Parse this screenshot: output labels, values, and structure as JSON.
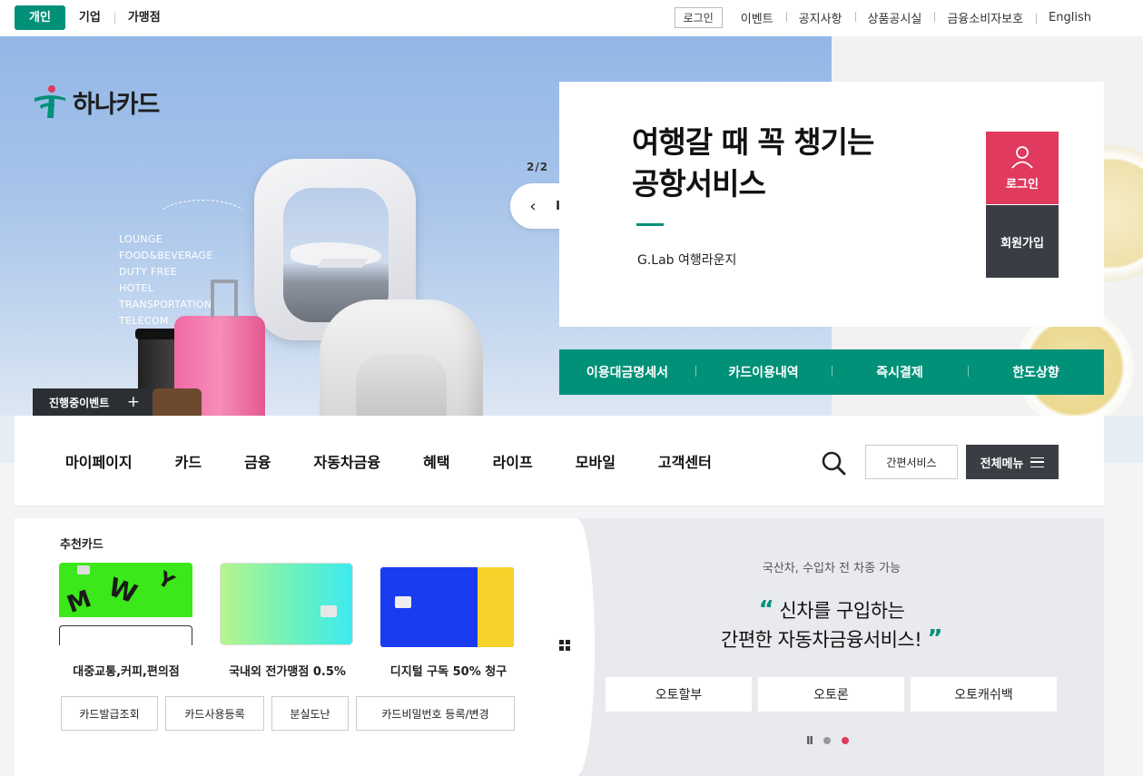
{
  "top_tabs": [
    "개인",
    "기업",
    "가맹점"
  ],
  "util": {
    "login": "로그인",
    "links": [
      "이벤트",
      "공지사항",
      "상품공시실",
      "금융소비자보호",
      "English"
    ]
  },
  "brand": {
    "name": "하나카드",
    "accent": "#009178"
  },
  "hero": {
    "keywords": [
      "LOUNGE",
      "FOOD&BEVERAGE",
      "DUTY FREE",
      "HOTEL",
      "TRANSPORTATION",
      "TELECOM"
    ],
    "event_tag": "진행중이벤트",
    "event_plus": "+",
    "counter": "2/2",
    "prev": "‹",
    "pause": "II",
    "next": "›"
  },
  "promo": {
    "title_line1": "여행갈 때 꼭 챙기는",
    "title_line2": "공항서비스",
    "subtitle": "G.Lab 여행라운지",
    "login": "로그인",
    "join": "회원가입"
  },
  "quick_links": [
    "이용대금명세서",
    "카드이용내역",
    "즉시결제",
    "한도상향"
  ],
  "gnb": {
    "menu": [
      "마이페이지",
      "카드",
      "금융",
      "자동차금융",
      "혜택",
      "라이프",
      "모바일",
      "고객센터"
    ],
    "easy_service": "간편서비스",
    "all_menu": "전체메뉴"
  },
  "reco": {
    "label": "추천카드",
    "cards": [
      "대중교통,커피,편의점",
      "국내외 전가맹점 0.5%",
      "디지털 구독 50% 청구"
    ],
    "buttons": [
      "카드발급조회",
      "카드사용등록",
      "분실도난",
      "카드비밀번호 등록/변경"
    ]
  },
  "auto": {
    "eyebrow": "국산차, 수입차 전 차종 가능",
    "open_quote": "“",
    "head_line1": "신차를 구입하는",
    "head_line2": "간편한 자동차금융서비스!",
    "close_quote": "”",
    "buttons": [
      "오토할부",
      "오토론",
      "오토캐쉬백"
    ],
    "pause": "II"
  }
}
